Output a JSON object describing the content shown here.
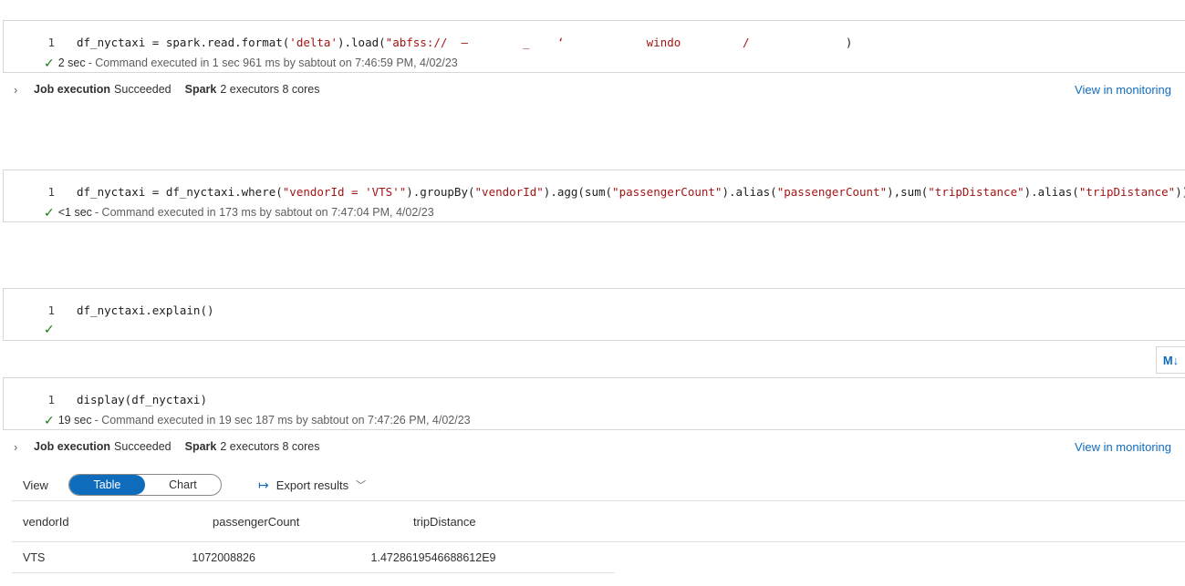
{
  "cells": [
    {
      "line_number": "1",
      "code_parts": [
        "df_nyctaxi = spark.read.format(",
        "'delta'",
        ").load(",
        "\"abfss://  —        _    ‘            windo         /              ",
        ")"
      ],
      "duration": "2 sec",
      "status_text": "- Command executed in 1 sec 961 ms by sabtout on 7:46:59 PM, 4/02/23",
      "job": {
        "label": "Job execution",
        "result": "Succeeded",
        "spark_label": "Spark",
        "spark_info": "2 executors 8 cores",
        "monitor_link": "View in monitoring"
      }
    },
    {
      "line_number": "1",
      "code_parts": [
        "df_nyctaxi = df_nyctaxi.where(",
        "\"vendorId = 'VTS'\"",
        ").groupBy(",
        "\"vendorId\"",
        ").agg(sum(",
        "\"passengerCount\"",
        ").alias(",
        "\"passengerCount\"",
        "),sum(",
        "\"tripDistance\"",
        ").alias(",
        "\"tripDistance\"",
        "))"
      ],
      "duration": "<1 sec",
      "status_text": "- Command executed in 173 ms by sabtout on 7:47:04 PM, 4/02/23"
    },
    {
      "line_number": "1",
      "code_parts": [
        "df_nyctaxi.explain()"
      ]
    },
    {
      "line_number": "1",
      "code_parts": [
        "display(df_nyctaxi)"
      ],
      "duration": "19 sec",
      "status_text": "- Command executed in 19 sec 187 ms by sabtout on 7:47:26 PM, 4/02/23",
      "job": {
        "label": "Job execution",
        "result": "Succeeded",
        "spark_label": "Spark",
        "spark_info": "2 executors 8 cores",
        "monitor_link": "View in monitoring"
      }
    }
  ],
  "markdown_button": "M↓",
  "results": {
    "view_label": "View",
    "view_options": [
      "Table",
      "Chart"
    ],
    "active_view": "Table",
    "export_label": "Export results",
    "columns": [
      "vendorId",
      "passengerCount",
      "tripDistance"
    ],
    "rows": [
      [
        "VTS",
        "1072008826",
        "1.4728619546688612E9"
      ]
    ]
  },
  "colors": {
    "accent": "#0f6cbd",
    "success": "#107c10",
    "string": "#a31515"
  },
  "icons": {
    "success": "check-icon",
    "expand": "chevron-right-icon",
    "export": "export-arrow-icon",
    "dropdown": "chevron-down-icon"
  }
}
